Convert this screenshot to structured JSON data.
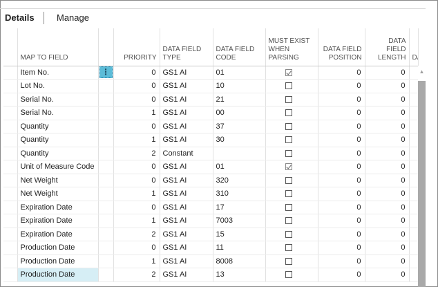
{
  "tabs": {
    "details": "Details",
    "manage": "Manage"
  },
  "columns": [
    {
      "key": "map_to_field",
      "label": "MAP TO FIELD"
    },
    {
      "key": "priority",
      "label": "PRIORITY"
    },
    {
      "key": "data_field_type",
      "label": "DATA FIELD TYPE"
    },
    {
      "key": "data_field_code",
      "label": "DATA FIELD CODE"
    },
    {
      "key": "must_exist",
      "label": "MUST EXIST WHEN PARSING"
    },
    {
      "key": "data_field_position",
      "label": "DATA FIELD POSITION"
    },
    {
      "key": "data_field_length",
      "label": "DATA FIELD LENGTH"
    },
    {
      "key": "next",
      "label": "DATA"
    }
  ],
  "context_menu_icon": "⋮",
  "rows": [
    {
      "map_to_field": "Item No.",
      "priority": "0",
      "data_field_type": "GS1 AI",
      "data_field_code": "01",
      "must_exist": true,
      "position": "0",
      "length": "0"
    },
    {
      "map_to_field": "Lot No.",
      "priority": "0",
      "data_field_type": "GS1 AI",
      "data_field_code": "10",
      "must_exist": false,
      "position": "0",
      "length": "0"
    },
    {
      "map_to_field": "Serial No.",
      "priority": "0",
      "data_field_type": "GS1 AI",
      "data_field_code": "21",
      "must_exist": false,
      "position": "0",
      "length": "0"
    },
    {
      "map_to_field": "Serial No.",
      "priority": "1",
      "data_field_type": "GS1 AI",
      "data_field_code": "00",
      "must_exist": false,
      "position": "0",
      "length": "0"
    },
    {
      "map_to_field": "Quantity",
      "priority": "0",
      "data_field_type": "GS1 AI",
      "data_field_code": "37",
      "must_exist": false,
      "position": "0",
      "length": "0"
    },
    {
      "map_to_field": "Quantity",
      "priority": "1",
      "data_field_type": "GS1 AI",
      "data_field_code": "30",
      "must_exist": false,
      "position": "0",
      "length": "0"
    },
    {
      "map_to_field": "Quantity",
      "priority": "2",
      "data_field_type": "Constant",
      "data_field_code": "",
      "must_exist": false,
      "position": "0",
      "length": "0"
    },
    {
      "map_to_field": "Unit of Measure Code",
      "priority": "0",
      "data_field_type": "GS1 AI",
      "data_field_code": "01",
      "must_exist": true,
      "position": "0",
      "length": "0"
    },
    {
      "map_to_field": "Net Weight",
      "priority": "0",
      "data_field_type": "GS1 AI",
      "data_field_code": "320",
      "must_exist": false,
      "position": "0",
      "length": "0"
    },
    {
      "map_to_field": "Net Weight",
      "priority": "1",
      "data_field_type": "GS1 AI",
      "data_field_code": "310",
      "must_exist": false,
      "position": "0",
      "length": "0"
    },
    {
      "map_to_field": "Expiration Date",
      "priority": "0",
      "data_field_type": "GS1 AI",
      "data_field_code": "17",
      "must_exist": false,
      "position": "0",
      "length": "0"
    },
    {
      "map_to_field": "Expiration Date",
      "priority": "1",
      "data_field_type": "GS1 AI",
      "data_field_code": "7003",
      "must_exist": false,
      "position": "0",
      "length": "0"
    },
    {
      "map_to_field": "Expiration Date",
      "priority": "2",
      "data_field_type": "GS1 AI",
      "data_field_code": "15",
      "must_exist": false,
      "position": "0",
      "length": "0"
    },
    {
      "map_to_field": "Production Date",
      "priority": "0",
      "data_field_type": "GS1 AI",
      "data_field_code": "11",
      "must_exist": false,
      "position": "0",
      "length": "0"
    },
    {
      "map_to_field": "Production Date",
      "priority": "1",
      "data_field_type": "GS1 AI",
      "data_field_code": "8008",
      "must_exist": false,
      "position": "0",
      "length": "0"
    },
    {
      "map_to_field": "Production Date",
      "priority": "2",
      "data_field_type": "GS1 AI",
      "data_field_code": "13",
      "must_exist": false,
      "position": "0",
      "length": "0"
    }
  ],
  "selected_row_index": 0,
  "focused_cell_row_index": 15,
  "colors": {
    "accent": "#5bbcd8",
    "focus_bg": "#d6eef5",
    "scrollbar": "#a9a9a9"
  }
}
